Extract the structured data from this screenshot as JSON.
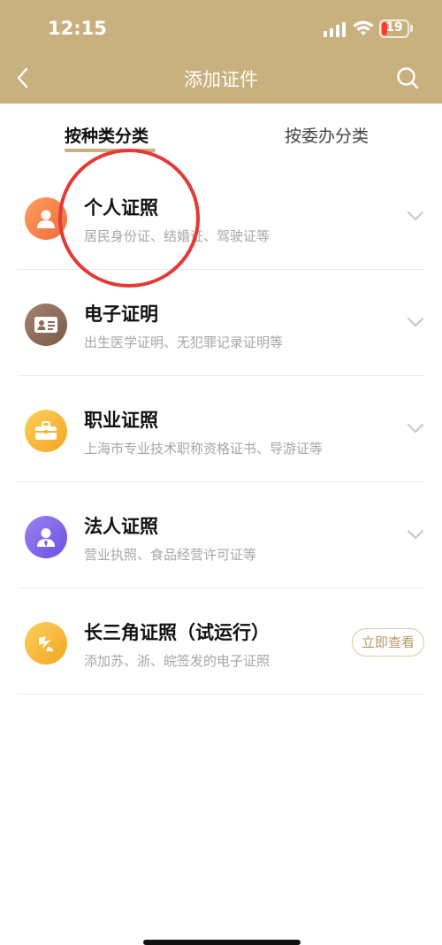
{
  "status_bar": {
    "time": "12:15",
    "battery": "19"
  },
  "header": {
    "title": "添加证件"
  },
  "tabs": [
    {
      "label": "按种类分类",
      "active": true
    },
    {
      "label": "按委办分类",
      "active": false
    }
  ],
  "items": [
    {
      "title": "个人证照",
      "subtitle": "居民身份证、结婚证、驾驶证等",
      "icon": "person-icon",
      "color": "#f6874a"
    },
    {
      "title": "电子证明",
      "subtitle": "出生医学证明、无犯罪记录证明等",
      "icon": "id-card-icon",
      "color": "#8c6a58"
    },
    {
      "title": "职业证照",
      "subtitle": "上海市专业技术职称资格证书、导游证等",
      "icon": "briefcase-icon",
      "color": "#f7b733"
    },
    {
      "title": "法人证照",
      "subtitle": "营业执照、食品经营许可证等",
      "icon": "corporate-person-icon",
      "color": "#7b61e8"
    },
    {
      "title": "长三角证照（试运行）",
      "subtitle": "添加苏、浙、皖签发的电子证照",
      "icon": "yangtze-delta-icon",
      "color": "#f7b733",
      "action": "立即查看"
    }
  ],
  "colors": {
    "header_bg": "#c9b17f",
    "accent": "#c9b17f",
    "annotation": "#e53935"
  }
}
